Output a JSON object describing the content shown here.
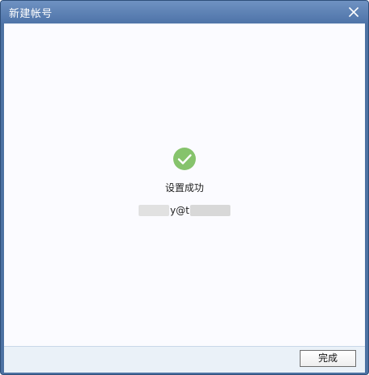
{
  "window": {
    "title": "新建帐号",
    "close_icon": "close-icon"
  },
  "main": {
    "status_icon": "check-circle-icon",
    "status_text": "设置成功",
    "account_visible_text": "y@t"
  },
  "footer": {
    "done_label": "完成"
  },
  "colors": {
    "titlebar_top": "#6f92c2",
    "titlebar_bottom": "#4e73a8",
    "content_bg": "#fbfbff",
    "success_green": "#86c36c",
    "footer_bg": "#eaf1f8"
  }
}
